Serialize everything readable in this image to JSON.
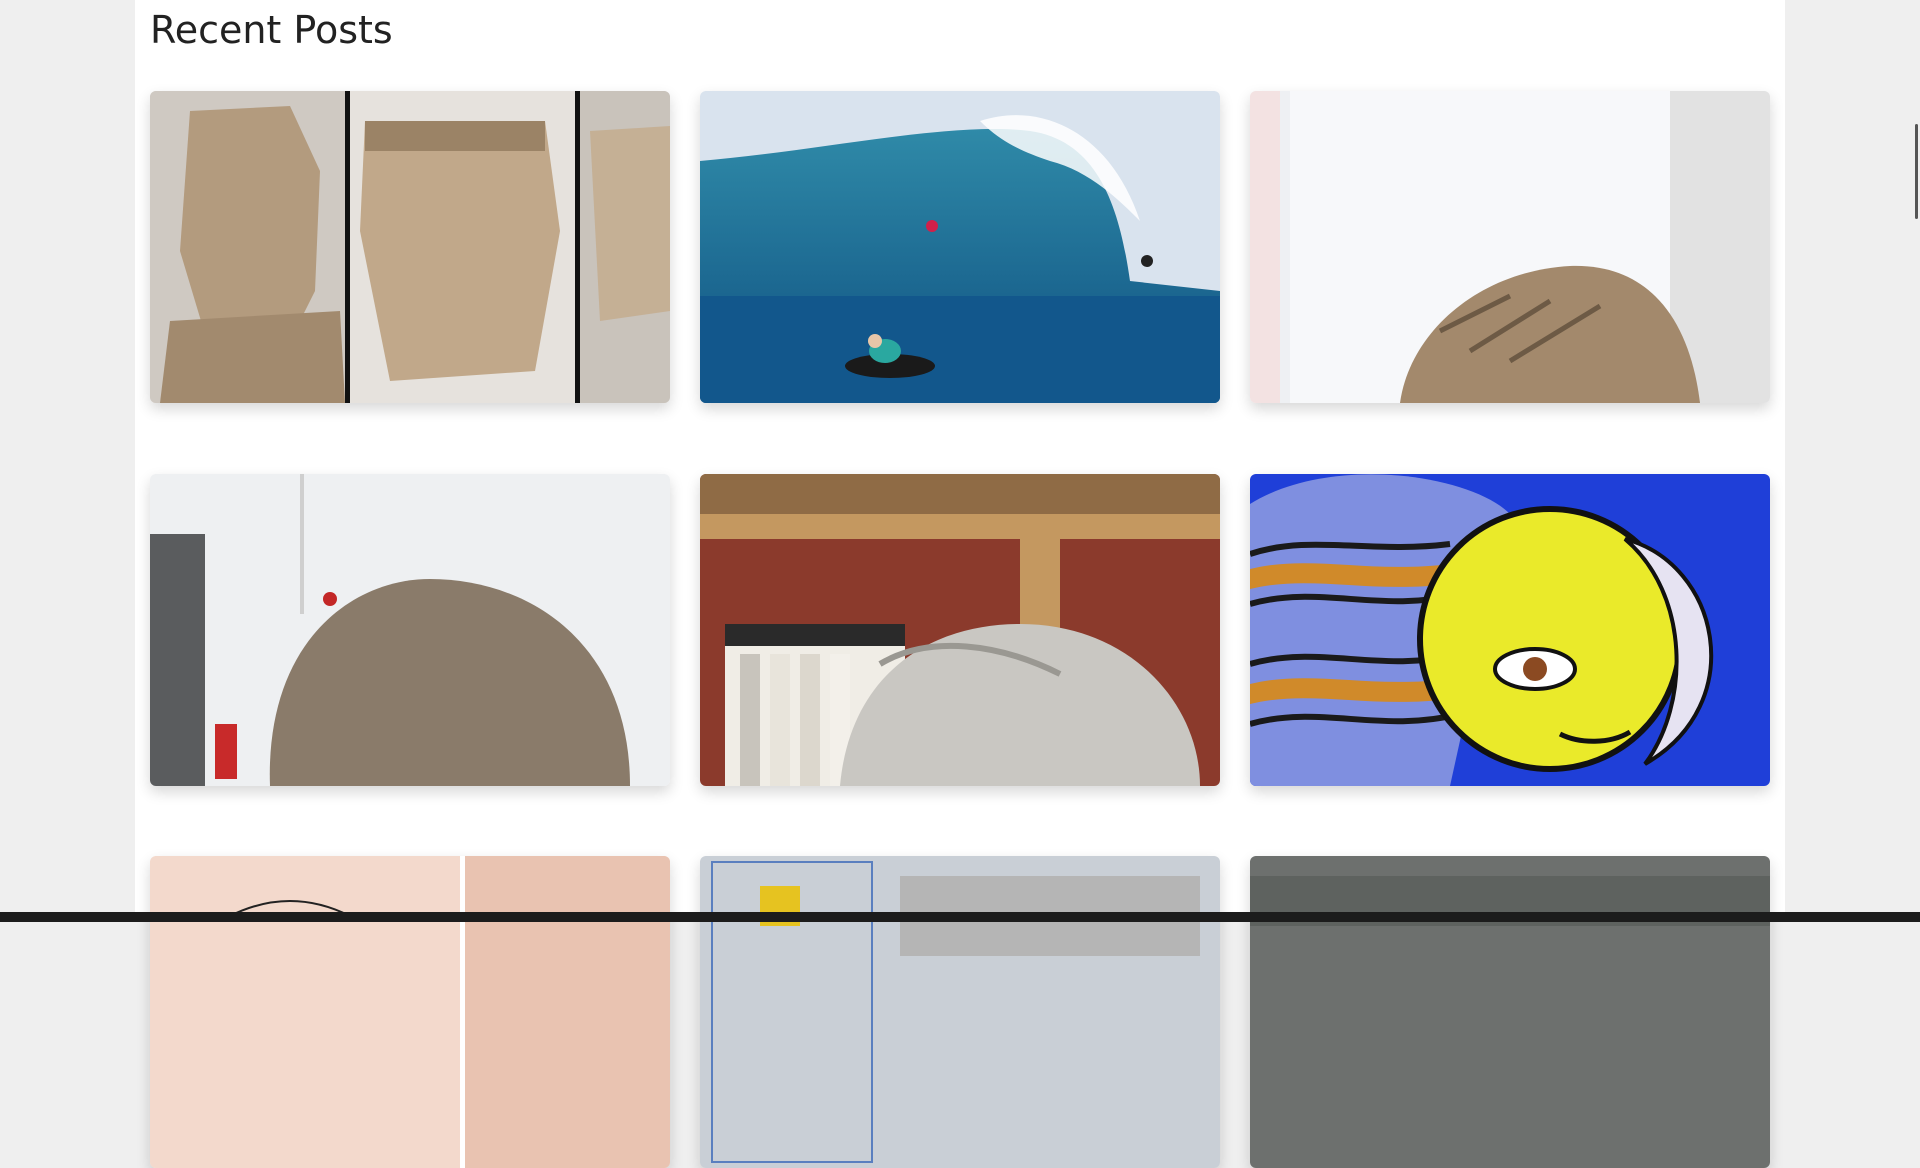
{
  "section": {
    "title": "Recent Posts"
  },
  "posts": [
    {
      "name": "post-card-cardboard-heads"
    },
    {
      "name": "post-card-surfers-wave"
    },
    {
      "name": "post-card-cardboard-head-window"
    },
    {
      "name": "post-card-clay-head"
    },
    {
      "name": "post-card-clay-bust-bookshelf"
    },
    {
      "name": "post-card-stained-glass-sun-moon"
    },
    {
      "name": "post-card-face-sketch"
    },
    {
      "name": "post-card-yellow-sculpture"
    },
    {
      "name": "post-card-stone-texture"
    }
  ]
}
